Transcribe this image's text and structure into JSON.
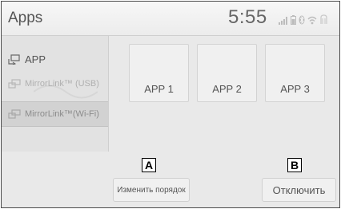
{
  "header": {
    "title": "Apps",
    "clock": "5:55"
  },
  "status_icons": [
    "signal-icon",
    "battery-icon",
    "bluetooth-icon",
    "wifi-icon",
    "connection-icon"
  ],
  "sidebar": {
    "items": [
      {
        "label": "APP",
        "icon": "app-icon"
      },
      {
        "label": "MirrorLink™ (USB)",
        "icon": "mirrorlink-icon"
      },
      {
        "label": "MirrorLink™(Wi-Fi)",
        "icon": "mirrorlink-icon"
      }
    ]
  },
  "apps": [
    {
      "label": "APP 1"
    },
    {
      "label": "APP 2"
    },
    {
      "label": "APP 3"
    }
  ],
  "buttons": {
    "reorder_label": "Изменить порядок",
    "disconnect_label": "Отключить"
  },
  "markers": {
    "a": "A",
    "b": "B"
  }
}
